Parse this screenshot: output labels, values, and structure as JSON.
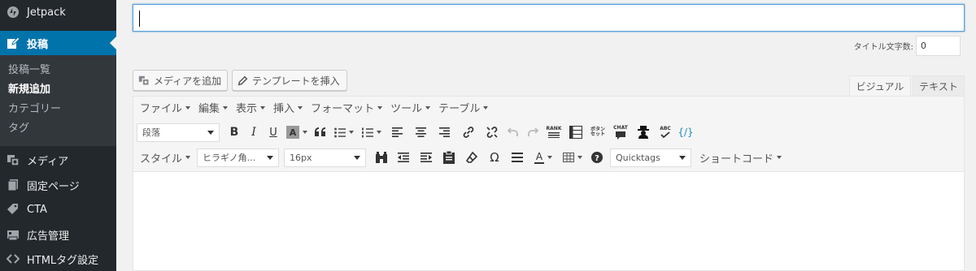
{
  "sidebar": {
    "items": [
      {
        "label": "Jetpack",
        "icon": "jetpack-icon"
      },
      {
        "label": "投稿",
        "icon": "posts-icon"
      },
      {
        "label": "メディア",
        "icon": "media-icon"
      },
      {
        "label": "固定ページ",
        "icon": "pages-icon"
      },
      {
        "label": "CTA",
        "icon": "cta-icon"
      },
      {
        "label": "広告管理",
        "icon": "ads-icon"
      },
      {
        "label": "HTMLタグ設定",
        "icon": "code-icon"
      }
    ],
    "submenu": [
      "投稿一覧",
      "新規追加",
      "カテゴリー",
      "タグ"
    ],
    "active_color": "#0073aa",
    "background": "#23282d"
  },
  "title": {
    "value": "",
    "count_label": "タイトル文字数:",
    "count_value": "0"
  },
  "media_buttons": {
    "add_media": "メディアを追加",
    "insert_template": "テンプレートを挿入"
  },
  "tabs": {
    "visual": "ビジュアル",
    "text": "テキスト"
  },
  "menubar": [
    "ファイル",
    "編集",
    "表示",
    "挿入",
    "フォーマット",
    "ツール",
    "テーブル"
  ],
  "toolbar": {
    "format_select": "段落",
    "style_label": "スタイル",
    "font_family": "ヒラギノ角...",
    "font_size": "16px",
    "quicktags": "Quicktags",
    "shortcode": "ショートコード",
    "rank_label": "RANK",
    "chat_label": "CHAT",
    "abc_label": "ABC",
    "box_label": "ボタン",
    "set_label": "セット"
  }
}
